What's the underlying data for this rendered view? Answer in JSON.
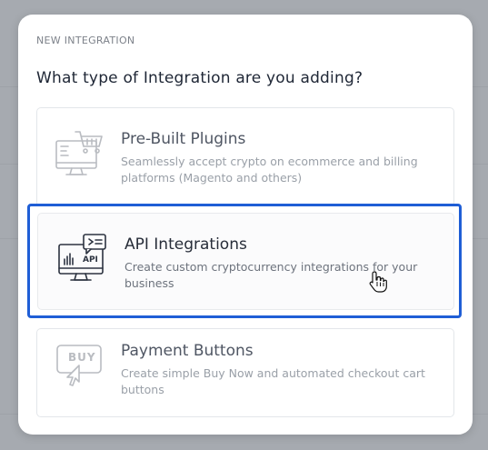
{
  "modal": {
    "eyebrow": "NEW INTEGRATION",
    "heading": "What type of Integration are you adding?"
  },
  "options": [
    {
      "title": "Pre-Built Plugins",
      "description": "Seamlessly accept crypto on ecommerce and billing platforms (Magento and others)",
      "icon": "cart-monitor-icon",
      "state": "disabled"
    },
    {
      "title": "API Integrations",
      "description": "Create custom cryptocurrency integrations for your business",
      "icon": "api-monitor-icon",
      "icon_label": "API",
      "state": "highlighted"
    },
    {
      "title": "Payment Buttons",
      "description": "Create simple Buy Now and automated checkout cart buttons",
      "icon": "buy-button-icon",
      "icon_label": "BUY",
      "state": "disabled"
    }
  ],
  "colors": {
    "highlight": "#1f5ed6",
    "heading": "#1e2635",
    "backdrop": "#a6aab0"
  },
  "cursor": "hand-pointer-icon"
}
